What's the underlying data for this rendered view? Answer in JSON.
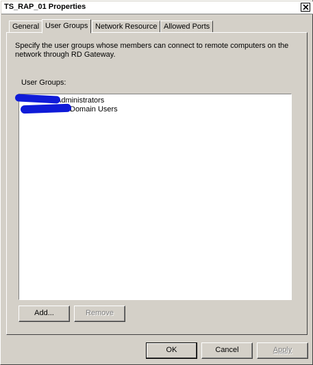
{
  "window": {
    "title": "TS_RAP_01 Properties"
  },
  "tabs": [
    {
      "label": "General",
      "active": false
    },
    {
      "label": "User Groups",
      "active": true
    },
    {
      "label": "Network Resource",
      "active": false
    },
    {
      "label": "Allowed Ports",
      "active": false
    }
  ],
  "panel": {
    "description": "Specify the user groups whose members can connect to remote computers on the network through RD Gateway.",
    "groups_label": "User Groups:",
    "groups": [
      {
        "label": "Administrators"
      },
      {
        "label": "Domain Users"
      }
    ],
    "add_label": "Add...",
    "remove_label": "Remove"
  },
  "footer": {
    "ok_label": "OK",
    "cancel_label": "Cancel",
    "apply_label": "Apply"
  },
  "colors": {
    "face": "#d4d0c8",
    "redaction": "#0f1bd8"
  },
  "icons": {
    "close": "close-icon"
  }
}
